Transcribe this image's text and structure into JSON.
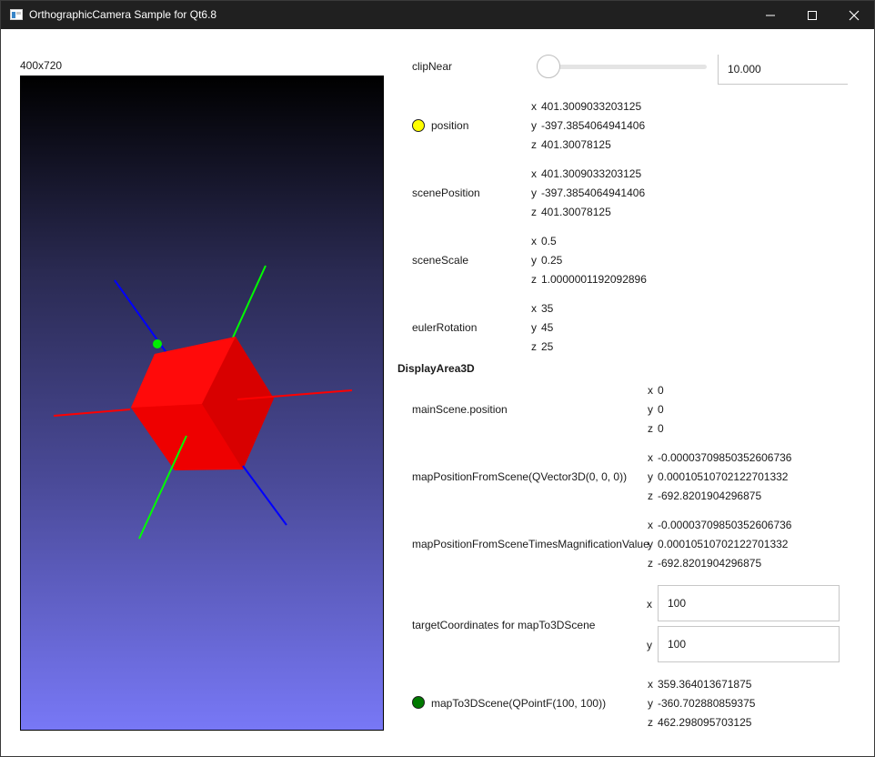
{
  "window": {
    "title": "OrthographicCamera Sample for Qt6.8"
  },
  "viewport": {
    "size_label": "400x720"
  },
  "clipNear": {
    "label": "clipNear",
    "value": "10.000",
    "slider_position": 0
  },
  "position": {
    "label": "position",
    "x": "401.3009033203125",
    "y": "-397.3854064941406",
    "z": "401.30078125",
    "indicator_color": "#ffff00"
  },
  "scenePosition": {
    "label": "scenePosition",
    "x": "401.3009033203125",
    "y": "-397.3854064941406",
    "z": "401.30078125"
  },
  "sceneScale": {
    "label": "sceneScale",
    "x": "0.5",
    "y": "0.25",
    "z": "1.0000001192092896"
  },
  "eulerRotation": {
    "label": "eulerRotation",
    "x": "35",
    "y": "45",
    "z": "25"
  },
  "displayArea": {
    "header": "DisplayArea3D"
  },
  "mainScenePosition": {
    "label": "mainScene.position",
    "x": "0",
    "y": "0",
    "z": "0"
  },
  "mapPositionFromScene": {
    "label": "mapPositionFromScene(QVector3D(0, 0, 0))",
    "x": "-0.00003709850352606736",
    "y": "0.00010510702122701332",
    "z": "-692.8201904296875"
  },
  "mapPositionFromSceneTimesMagnification": {
    "label": "mapPositionFromSceneTimesMagnificationValue",
    "x": "-0.00003709850352606736",
    "y": "0.00010510702122701332",
    "z": "-692.8201904296875"
  },
  "targetCoordinates": {
    "label": "targetCoordinates for mapTo3DScene",
    "x": "100",
    "y": "100"
  },
  "mapTo3DScene": {
    "label": "mapTo3DScene(QPointF(100, 100))",
    "x": "359.364013671875",
    "y": "-360.702880859375",
    "z": "462.298095703125",
    "indicator_color": "#007a00"
  },
  "axis_labels": {
    "x": "x",
    "y": "y",
    "z": "z"
  },
  "colors": {
    "axis_x": "#ff0000",
    "axis_y": "#00ff00",
    "axis_z": "#0000ff",
    "cube": "#ff0000"
  }
}
